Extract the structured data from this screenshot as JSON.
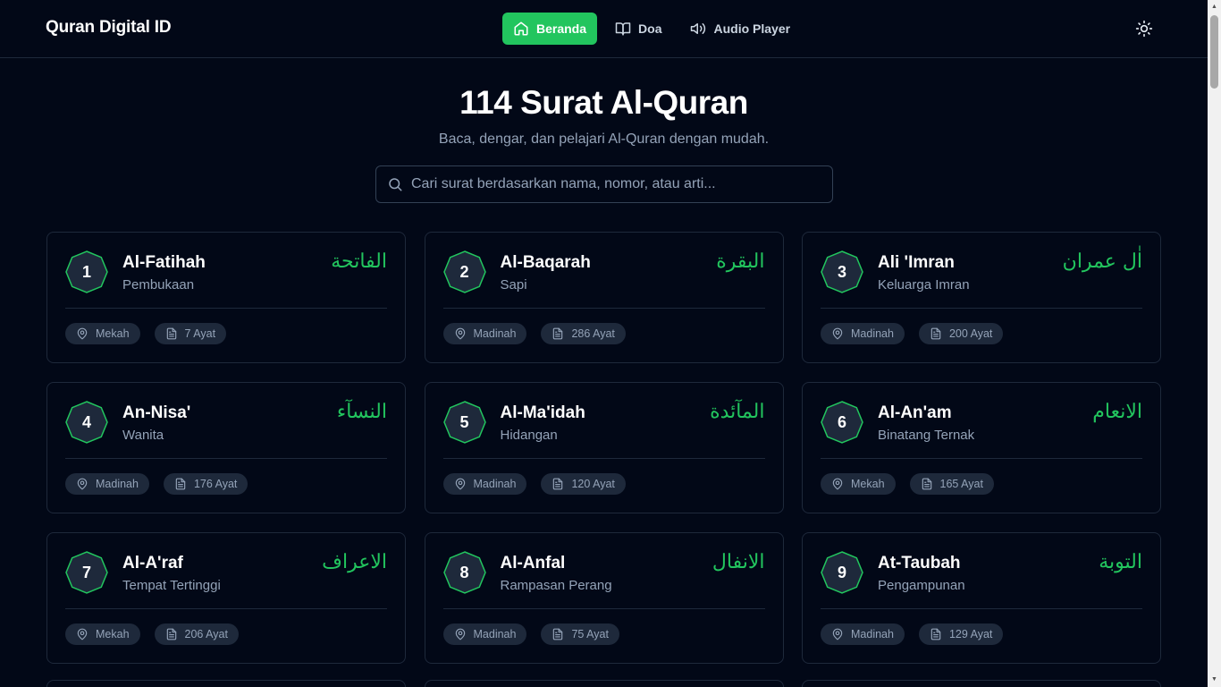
{
  "header": {
    "brand": "Quran Digital ID",
    "nav": [
      {
        "label": "Beranda",
        "icon": "home-icon",
        "active": true
      },
      {
        "label": "Doa",
        "icon": "book-open-icon",
        "active": false
      },
      {
        "label": "Audio Player",
        "icon": "speaker-icon",
        "active": false
      }
    ],
    "theme_icon": "sun-icon"
  },
  "hero": {
    "title": "114 Surat Al-Quran",
    "subtitle": "Baca, dengar, dan pelajari Al-Quran dengan mudah."
  },
  "search": {
    "placeholder": "Cari surat berdasarkan nama, nomor, atau arti...",
    "value": ""
  },
  "colors": {
    "accent": "#22c55e",
    "background": "#020817",
    "card_border": "#1e293b",
    "muted_text": "#94a3b8"
  },
  "surahs": [
    {
      "number": "1",
      "name": "Al-Fatihah",
      "meaning": "Pembukaan",
      "arabic": "الفاتحة",
      "place": "Mekah",
      "ayat": "7 Ayat"
    },
    {
      "number": "2",
      "name": "Al-Baqarah",
      "meaning": "Sapi",
      "arabic": "البقرة",
      "place": "Madinah",
      "ayat": "286 Ayat"
    },
    {
      "number": "3",
      "name": "Ali 'Imran",
      "meaning": "Keluarga Imran",
      "arabic": "اٰل عمران",
      "place": "Madinah",
      "ayat": "200 Ayat"
    },
    {
      "number": "4",
      "name": "An-Nisa'",
      "meaning": "Wanita",
      "arabic": "النسآء",
      "place": "Madinah",
      "ayat": "176 Ayat"
    },
    {
      "number": "5",
      "name": "Al-Ma'idah",
      "meaning": "Hidangan",
      "arabic": "المآئدة",
      "place": "Madinah",
      "ayat": "120 Ayat"
    },
    {
      "number": "6",
      "name": "Al-An'am",
      "meaning": "Binatang Ternak",
      "arabic": "الانعام",
      "place": "Mekah",
      "ayat": "165 Ayat"
    },
    {
      "number": "7",
      "name": "Al-A'raf",
      "meaning": "Tempat Tertinggi",
      "arabic": "الاعراف",
      "place": "Mekah",
      "ayat": "206 Ayat"
    },
    {
      "number": "8",
      "name": "Al-Anfal",
      "meaning": "Rampasan Perang",
      "arabic": "الانفال",
      "place": "Madinah",
      "ayat": "75 Ayat"
    },
    {
      "number": "9",
      "name": "At-Taubah",
      "meaning": "Pengampunan",
      "arabic": "التوبة",
      "place": "Madinah",
      "ayat": "129 Ayat"
    }
  ]
}
